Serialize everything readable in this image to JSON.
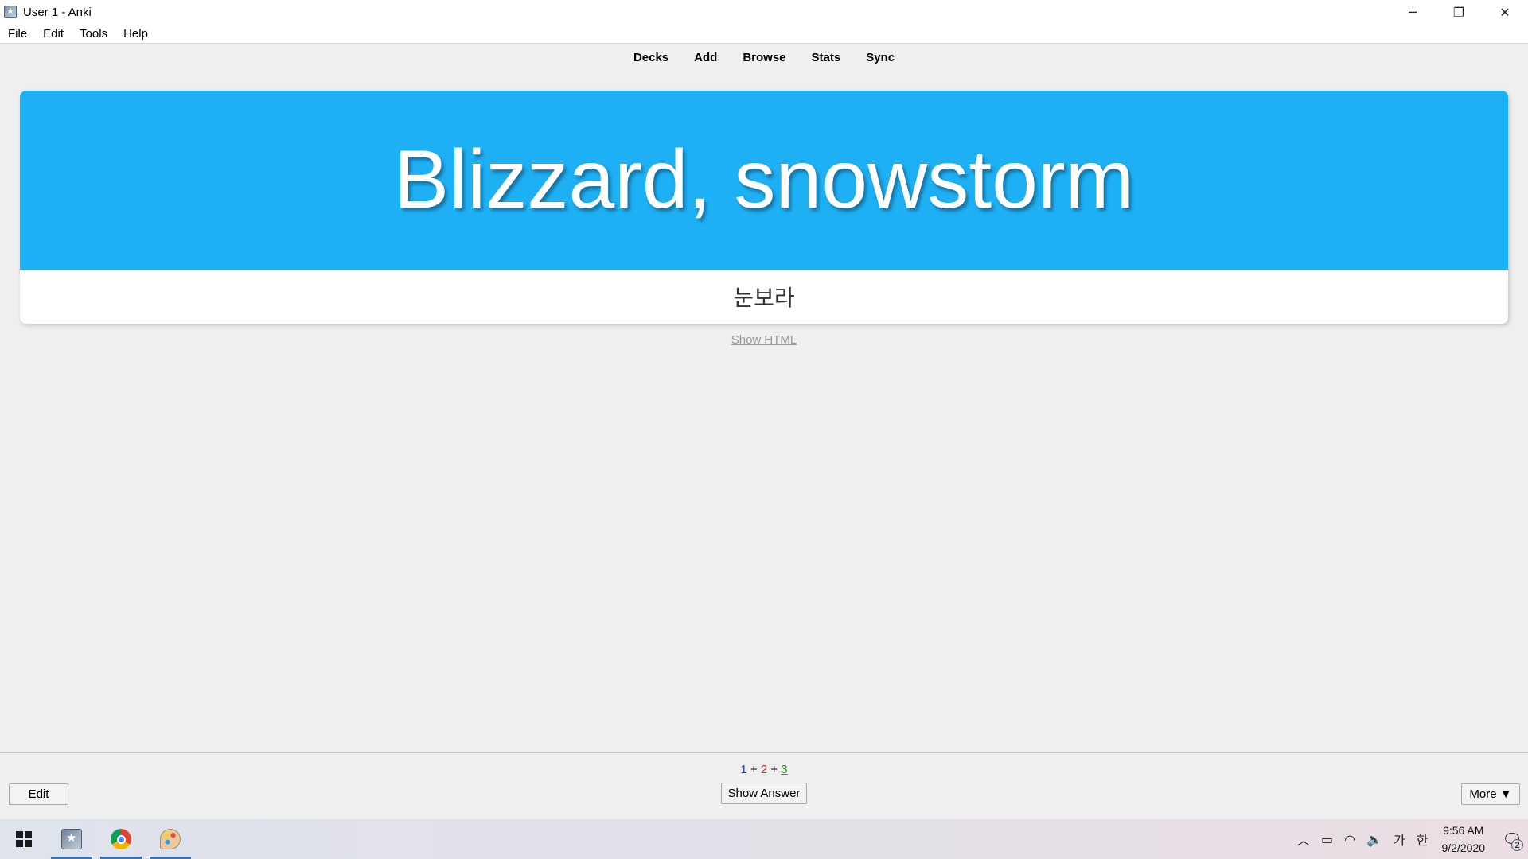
{
  "window": {
    "title": "User 1 - Anki",
    "minimize": "─",
    "maximize": "❐",
    "close": "✕"
  },
  "menu": {
    "items": [
      {
        "label": "File"
      },
      {
        "label": "Edit"
      },
      {
        "label": "Tools"
      },
      {
        "label": "Help"
      }
    ]
  },
  "toolbar": {
    "links": [
      "Decks",
      "Add",
      "Browse",
      "Stats",
      "Sync"
    ]
  },
  "card": {
    "front": "Blizzard, snowstorm",
    "back": "눈보라",
    "front_bg": "#1eb0f5"
  },
  "reviewer": {
    "show_html": "Show HTML"
  },
  "bottom": {
    "counts": {
      "new": "1",
      "learn": "2",
      "review": "3",
      "sep": "+"
    },
    "edit_label": "Edit",
    "show_answer_label": "Show Answer",
    "more_label": "More ▼"
  },
  "taskbar": {
    "apps": [
      "anki-icon",
      "chrome-icon",
      "paint-icon"
    ],
    "tray": {
      "chevron": "︿",
      "battery": "▭",
      "wifi": "◠",
      "volume": "🔈",
      "ime_lang": "가",
      "ime_mode": "한"
    },
    "time": "9:56 AM",
    "date": "9/2/2020",
    "notifications": "2"
  }
}
